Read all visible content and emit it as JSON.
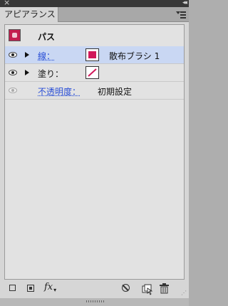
{
  "panel": {
    "tab_label": "アピアランス",
    "object_title": "パス"
  },
  "rows": {
    "stroke": {
      "label": "線：",
      "value": "散布ブラシ 1",
      "swatch_color": "#d1185a"
    },
    "fill": {
      "label": "塗り：",
      "swatch": "none-red-slash"
    },
    "opacity": {
      "label": "不透明度：",
      "value": "初期設定"
    }
  },
  "toolbar": {
    "fx_label": "fx"
  },
  "colors": {
    "selection": "#c9d7f3",
    "link": "#2a4fd6",
    "accent": "#c41e4f"
  }
}
